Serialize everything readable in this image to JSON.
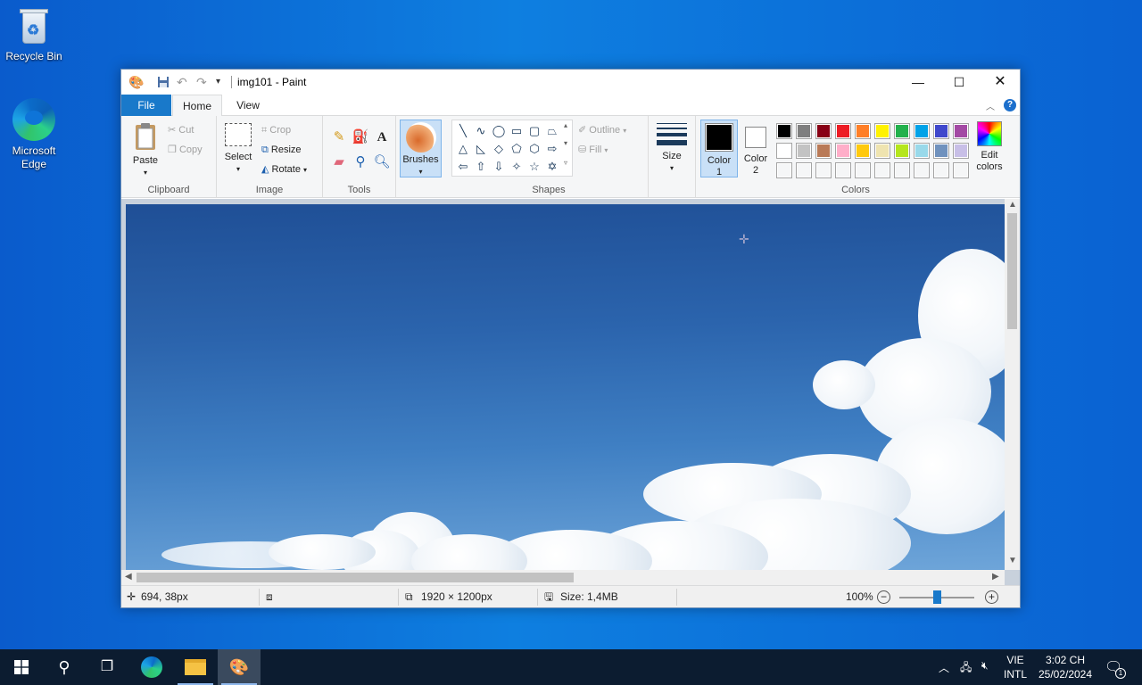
{
  "desktop": {
    "icons": [
      {
        "label": "Recycle Bin",
        "icon": "recycle-bin-icon"
      },
      {
        "label": "Microsoft Edge",
        "icon": "edge-icon"
      }
    ]
  },
  "window": {
    "title": "img101 - Paint",
    "quick_access": [
      "paint-app-icon",
      "save-icon",
      "undo-icon",
      "redo-icon",
      "customize-dropdown-icon"
    ],
    "controls": [
      "minimize",
      "maximize",
      "close"
    ]
  },
  "tabs": {
    "file": "File",
    "home": "Home",
    "view": "View"
  },
  "ribbon": {
    "clipboard": {
      "label": "Clipboard",
      "paste": "Paste",
      "cut": "Cut",
      "copy": "Copy"
    },
    "image": {
      "label": "Image",
      "select": "Select",
      "crop": "Crop",
      "resize": "Resize",
      "rotate": "Rotate"
    },
    "tools": {
      "label": "Tools",
      "items": [
        "pencil",
        "fill",
        "text",
        "eraser",
        "color-picker",
        "magnifier"
      ]
    },
    "brushes": {
      "label": "Brushes"
    },
    "shapes": {
      "label": "Shapes",
      "outline": "Outline",
      "fill": "Fill",
      "items": [
        "line",
        "curve",
        "oval",
        "rectangle",
        "rounded-rectangle",
        "polygon",
        "triangle",
        "right-triangle",
        "diamond",
        "pentagon",
        "hexagon",
        "right-arrow",
        "left-arrow",
        "up-arrow",
        "down-arrow",
        "four-point-star",
        "five-point-star",
        "six-point-star"
      ]
    },
    "size": {
      "label": "Size"
    },
    "colors": {
      "label": "Colors",
      "color1_line1": "Color",
      "color1_line2": "1",
      "color1_value": "#000000",
      "color2_line1": "Color",
      "color2_line2": "2",
      "color2_value": "#ffffff",
      "edit_line1": "Edit",
      "edit_line2": "colors",
      "palette_row1": [
        "#000000",
        "#7f7f7f",
        "#880015",
        "#ed1c24",
        "#ff7f27",
        "#fff200",
        "#22b14c",
        "#00a2e8",
        "#3f48cc",
        "#a349a4"
      ],
      "palette_row2": [
        "#ffffff",
        "#c3c3c3",
        "#b97a57",
        "#ffaec9",
        "#ffc90e",
        "#efe4b0",
        "#b5e61d",
        "#99d9ea",
        "#7092be",
        "#c8bfe7"
      ],
      "palette_row3": [
        "#ffffff",
        "#ffffff",
        "#ffffff",
        "#ffffff",
        "#ffffff",
        "#ffffff",
        "#ffffff",
        "#ffffff",
        "#ffffff",
        "#ffffff"
      ]
    }
  },
  "statusbar": {
    "cursor_pos": "694, 38px",
    "image_dims": "1920 × 1200px",
    "file_size": "Size: 1,4MB",
    "zoom": "100%",
    "zoom_level": 0.5
  },
  "taskbar": {
    "items": [
      "start-button",
      "search-button",
      "task-view-button",
      "edge-taskbar-icon",
      "file-explorer-icon",
      "paint-taskbar-icon"
    ],
    "lang_top": "VIE",
    "lang_bottom": "INTL",
    "time": "3:02 CH",
    "date": "25/02/2024",
    "notification_count": "1"
  }
}
